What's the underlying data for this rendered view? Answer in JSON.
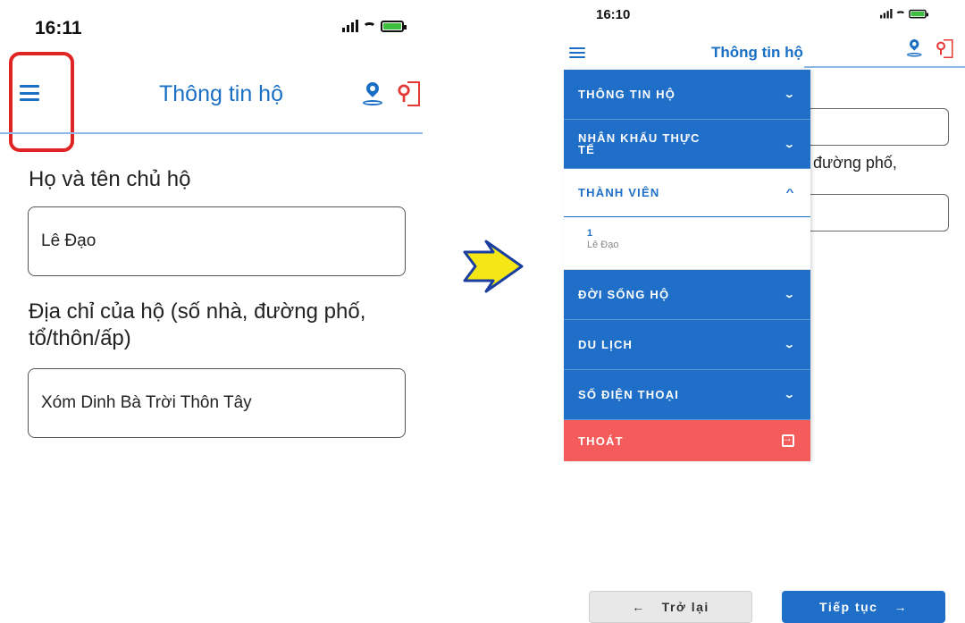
{
  "left_screen": {
    "time": "16:11",
    "header_title": "Thông tin hộ",
    "fields": [
      {
        "label": "Họ và tên chủ hộ",
        "value": "Lê Đạo"
      },
      {
        "label": "Địa chỉ của hộ (số nhà, đường phố,",
        "label2": "tổ/thôn/ấp)",
        "value": "Xóm Dinh Bà Trời Thôn Tây"
      }
    ]
  },
  "right_screen": {
    "time": "16:10",
    "header_title": "Thông tin hộ",
    "background_text": "đường phố,",
    "drawer": {
      "items": [
        {
          "label": "THÔNG TIN HỘ",
          "chevron": "⌄"
        },
        {
          "label": "NHÂN KHẨU THỰC",
          "label2": "TẾ",
          "chevron": "⌄"
        },
        {
          "label": "THÀNH VIÊN",
          "chevron": "^"
        },
        {
          "label": "ĐỜI SỐNG HỘ",
          "chevron": "⌄"
        },
        {
          "label": "DU LỊCH",
          "chevron": "⌄"
        },
        {
          "label": "SỐ ĐIỆN THOẠI",
          "chevron": "⌄"
        }
      ],
      "member": {
        "number": "1",
        "name": "Lê Đạo"
      },
      "exit_label": "THOÁT"
    },
    "buttons": {
      "back_arrow": "←",
      "back_label": "Trở lại",
      "next_label": "Tiếp tục",
      "next_arrow": "→"
    }
  },
  "colors": {
    "primary": "#1f6fc8",
    "exit": "#f45b5b",
    "highlight": "#e02424",
    "arrow_fill": "#f5e615"
  }
}
